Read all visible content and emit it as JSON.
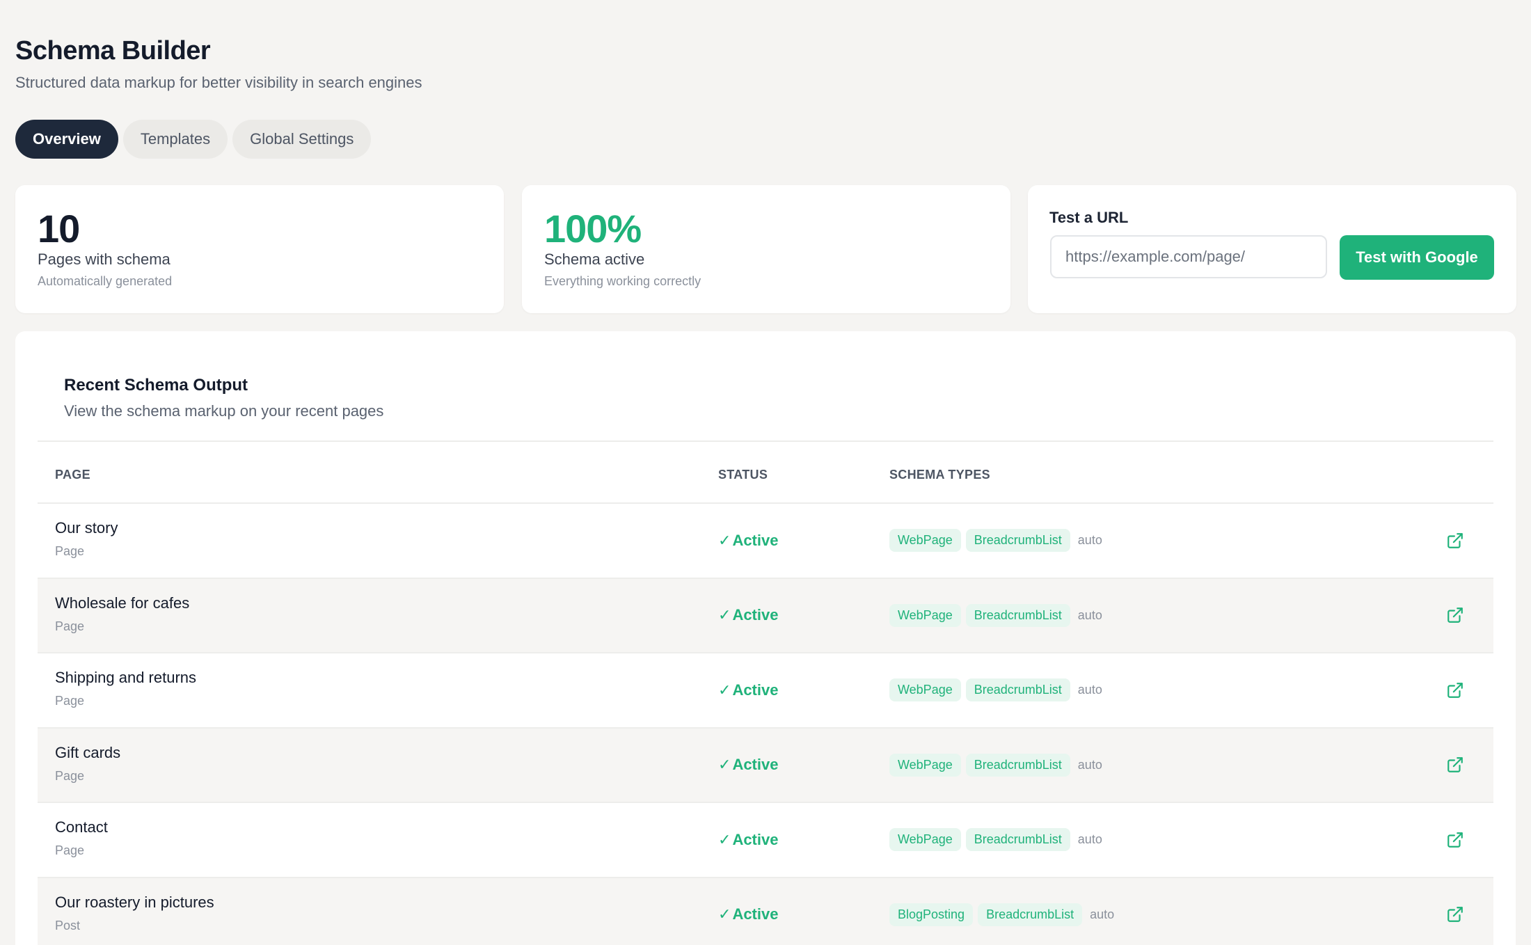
{
  "header": {
    "title": "Schema Builder",
    "subtitle": "Structured data markup for better visibility in search engines"
  },
  "tabs": [
    {
      "label": "Overview",
      "active": true
    },
    {
      "label": "Templates",
      "active": false
    },
    {
      "label": "Global Settings",
      "active": false
    }
  ],
  "stats": [
    {
      "value": "10",
      "label": "Pages with schema",
      "hint": "Automatically generated"
    },
    {
      "value": "100%",
      "label": "Schema active",
      "hint": "Everything working correctly"
    }
  ],
  "test_url": {
    "label": "Test a URL",
    "placeholder": "https://example.com/page/",
    "button_label": "Test with Google"
  },
  "recent": {
    "title": "Recent Schema Output",
    "subtitle": "View the schema markup on your recent pages",
    "columns": {
      "page": "PAGE",
      "status": "STATUS",
      "types": "SCHEMA TYPES"
    },
    "rows": [
      {
        "name": "Our story",
        "kind": "Page",
        "check": "✓",
        "status": "Active",
        "types": [
          "WebPage",
          "BreadcrumbList"
        ],
        "auto": "auto",
        "icon": "external-link-icon"
      },
      {
        "name": "Wholesale for cafes",
        "kind": "Page",
        "check": "✓",
        "status": "Active",
        "types": [
          "WebPage",
          "BreadcrumbList"
        ],
        "auto": "auto",
        "icon": "external-link-icon"
      },
      {
        "name": "Shipping and returns",
        "kind": "Page",
        "check": "✓",
        "status": "Active",
        "types": [
          "WebPage",
          "BreadcrumbList"
        ],
        "auto": "auto",
        "icon": "external-link-icon"
      },
      {
        "name": "Gift cards",
        "kind": "Page",
        "check": "✓",
        "status": "Active",
        "types": [
          "WebPage",
          "BreadcrumbList"
        ],
        "auto": "auto",
        "icon": "external-link-icon"
      },
      {
        "name": "Contact",
        "kind": "Page",
        "check": "✓",
        "status": "Active",
        "types": [
          "WebPage",
          "BreadcrumbList"
        ],
        "auto": "auto",
        "icon": "external-link-icon"
      },
      {
        "name": "Our roastery in pictures",
        "kind": "Post",
        "check": "✓",
        "status": "Active",
        "types": [
          "BlogPosting",
          "BreadcrumbList"
        ],
        "auto": "auto",
        "icon": "external-link-icon"
      }
    ]
  },
  "colors": {
    "accent": "#1fb27a",
    "tab_active": "#1e293b",
    "background": "#f5f4f2"
  }
}
